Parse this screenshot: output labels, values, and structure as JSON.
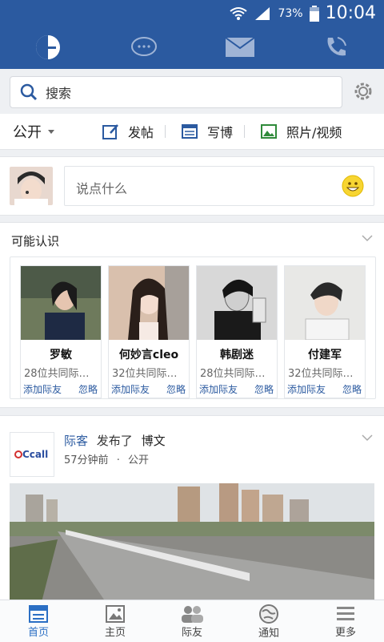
{
  "status": {
    "battery": "73%",
    "time": "10:04"
  },
  "top_tabs": [
    "home",
    "chat",
    "mail",
    "phone"
  ],
  "search": {
    "placeholder": "搜索"
  },
  "actions": {
    "privacy": "公开",
    "post": "发帖",
    "blog": "写博",
    "media": "照片/视频"
  },
  "composer": {
    "placeholder": "说点什么"
  },
  "pymk": {
    "title": "可能认识",
    "people": [
      {
        "name": "罗敏",
        "mutual": "28位共同际…",
        "add": "添加际友",
        "ignore": "忽略"
      },
      {
        "name": "何妙言cleo",
        "mutual": "32位共同际…",
        "add": "添加际友",
        "ignore": "忽略"
      },
      {
        "name": "韩剧迷",
        "mutual": "28位共同际…",
        "add": "添加际友",
        "ignore": "忽略"
      },
      {
        "name": "付建军",
        "mutual": "32位共同际…",
        "add": "添加际友",
        "ignore": "忽略"
      }
    ]
  },
  "post": {
    "author": "际客",
    "verb": "发布了",
    "type": "博文",
    "time": "57分钟前",
    "visibility": "公开",
    "logo_text": "Ccall"
  },
  "bottom_nav": [
    {
      "label": "首页",
      "active": true
    },
    {
      "label": "主页",
      "active": false
    },
    {
      "label": "际友",
      "active": false
    },
    {
      "label": "通知",
      "active": false
    },
    {
      "label": "更多",
      "active": false
    }
  ],
  "colors": {
    "brand": "#2b5aa0",
    "link": "#2b5aa0",
    "active": "#2b6fc4"
  }
}
